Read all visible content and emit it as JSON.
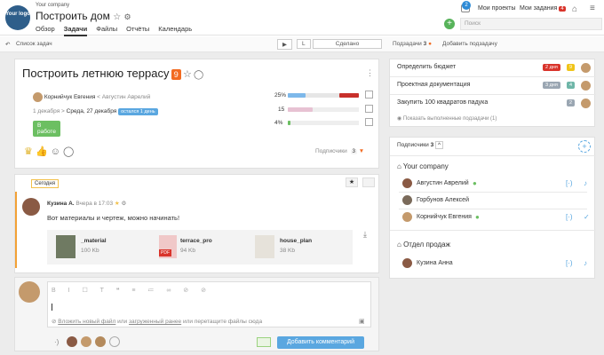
{
  "header": {
    "logo_text": "Your logo",
    "company": "Your company",
    "project_title": "Построить дом",
    "nav": [
      "Обзор",
      "Задачи",
      "Файлы",
      "Отчёты",
      "Календарь"
    ],
    "notif_count": "2",
    "my_projects": "Мои проекты",
    "my_tasks": "Мои задания",
    "my_tasks_count": "4",
    "search_placeholder": "Поиск"
  },
  "subbar": {
    "back_label": "Список задач",
    "done_label": "Сделано",
    "subtasks_label": "Подзадачи",
    "subtasks_count": "3",
    "add_subtask": "Добавить подзадачу"
  },
  "task": {
    "title": "Построить летнюю террасу",
    "count": "9",
    "assignee": "Корнийчук Евгения",
    "author": "Августин Аврелий",
    "start_date": "1 декабря",
    "end_date": "Среда, 27 декабря",
    "remaining": "остался 1 день",
    "status": "В работе",
    "progress_pct": "25%",
    "progress_value": 25,
    "hours_label": "15",
    "hours_fill": 0.35,
    "percent2": "4%",
    "percent2_value": 4,
    "subscribers_label": "Подписчики",
    "subscribers_count": "3"
  },
  "comments": {
    "today_label": "Сегодня",
    "author": "Кузина А.",
    "time": "Вчера в 17:03",
    "text": "Вот материалы и чертеж, можно начинать!",
    "files": [
      {
        "name": "_material",
        "size": "100 Kb"
      },
      {
        "name": "terrace_pro",
        "size": "94 Kb",
        "type": "PDF"
      },
      {
        "name": "house_plan",
        "size": "38 Kb"
      }
    ]
  },
  "editor": {
    "attach_new": "Вложить новый файл",
    "or1": "или",
    "uploaded": "загруженный ранее",
    "or2": "или",
    "drag": "перетащите файлы сюда",
    "submit": "Добавить комментарий"
  },
  "subtasks": [
    {
      "title": "Определить бюджет",
      "badge1": "2 дня",
      "badge2": "9",
      "color1": "#d9342b",
      "color2": "#f0c419"
    },
    {
      "title": "Проектная документация",
      "badge1": "3 дня",
      "badge2": "4",
      "color1": "#9aa6b2",
      "color2": "#6fb6a8"
    },
    {
      "title": "Закупить 100 квадратов падука",
      "badge1": "",
      "badge2": "2",
      "color1": "",
      "color2": "#9aa6b2"
    }
  ],
  "show_completed": "Показать выполненные подзадачи",
  "show_completed_count": "(1)",
  "subscribers": {
    "label": "Подписчики",
    "count": "3",
    "company_label": "Your company",
    "people": [
      "Августин Аврелий",
      "Горбунов Алексей",
      "Корнийчук Евгения"
    ],
    "sales_label": "Отдел продаж",
    "sales_people": [
      "Кузина Анна"
    ]
  }
}
